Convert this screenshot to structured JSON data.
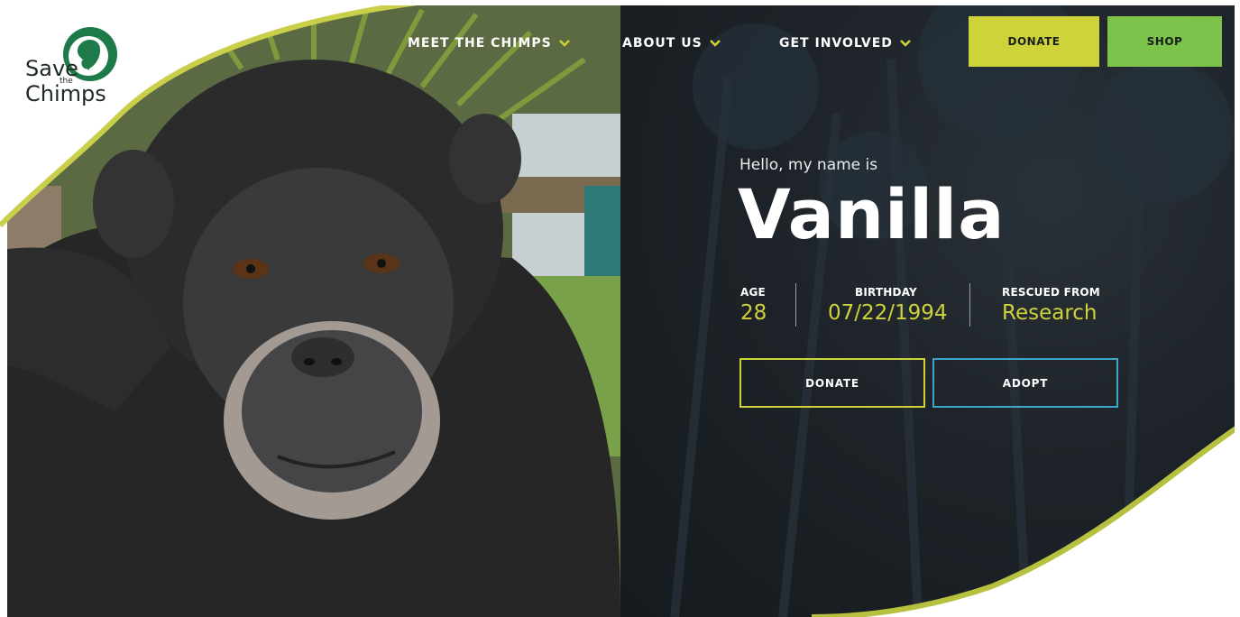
{
  "brand": {
    "logo_line1": "Save",
    "logo_line2": "the",
    "logo_line3": "Chimps",
    "green": "#1f7a4a",
    "accent_yellow": "#cfd33a",
    "accent_green": "#7dc24a",
    "accent_blue": "#3ea6c8"
  },
  "nav": {
    "items": [
      {
        "label": "MEET THE CHIMPS",
        "icon": "chevron-down-icon"
      },
      {
        "label": "ABOUT US",
        "icon": "chevron-down-icon"
      },
      {
        "label": "GET INVOLVED",
        "icon": "chevron-down-icon"
      }
    ],
    "donate_label": "DONATE",
    "shop_label": "SHOP"
  },
  "profile": {
    "greeting": "Hello, my name is",
    "name": "Vanilla",
    "age_label": "AGE",
    "age_value": "28",
    "birthday_label": "BIRTHDAY",
    "birthday_value": "07/22/1994",
    "rescued_label": "RESCUED FROM",
    "rescued_value": "Research",
    "donate_label": "DONATE",
    "adopt_label": "ADOPT"
  }
}
